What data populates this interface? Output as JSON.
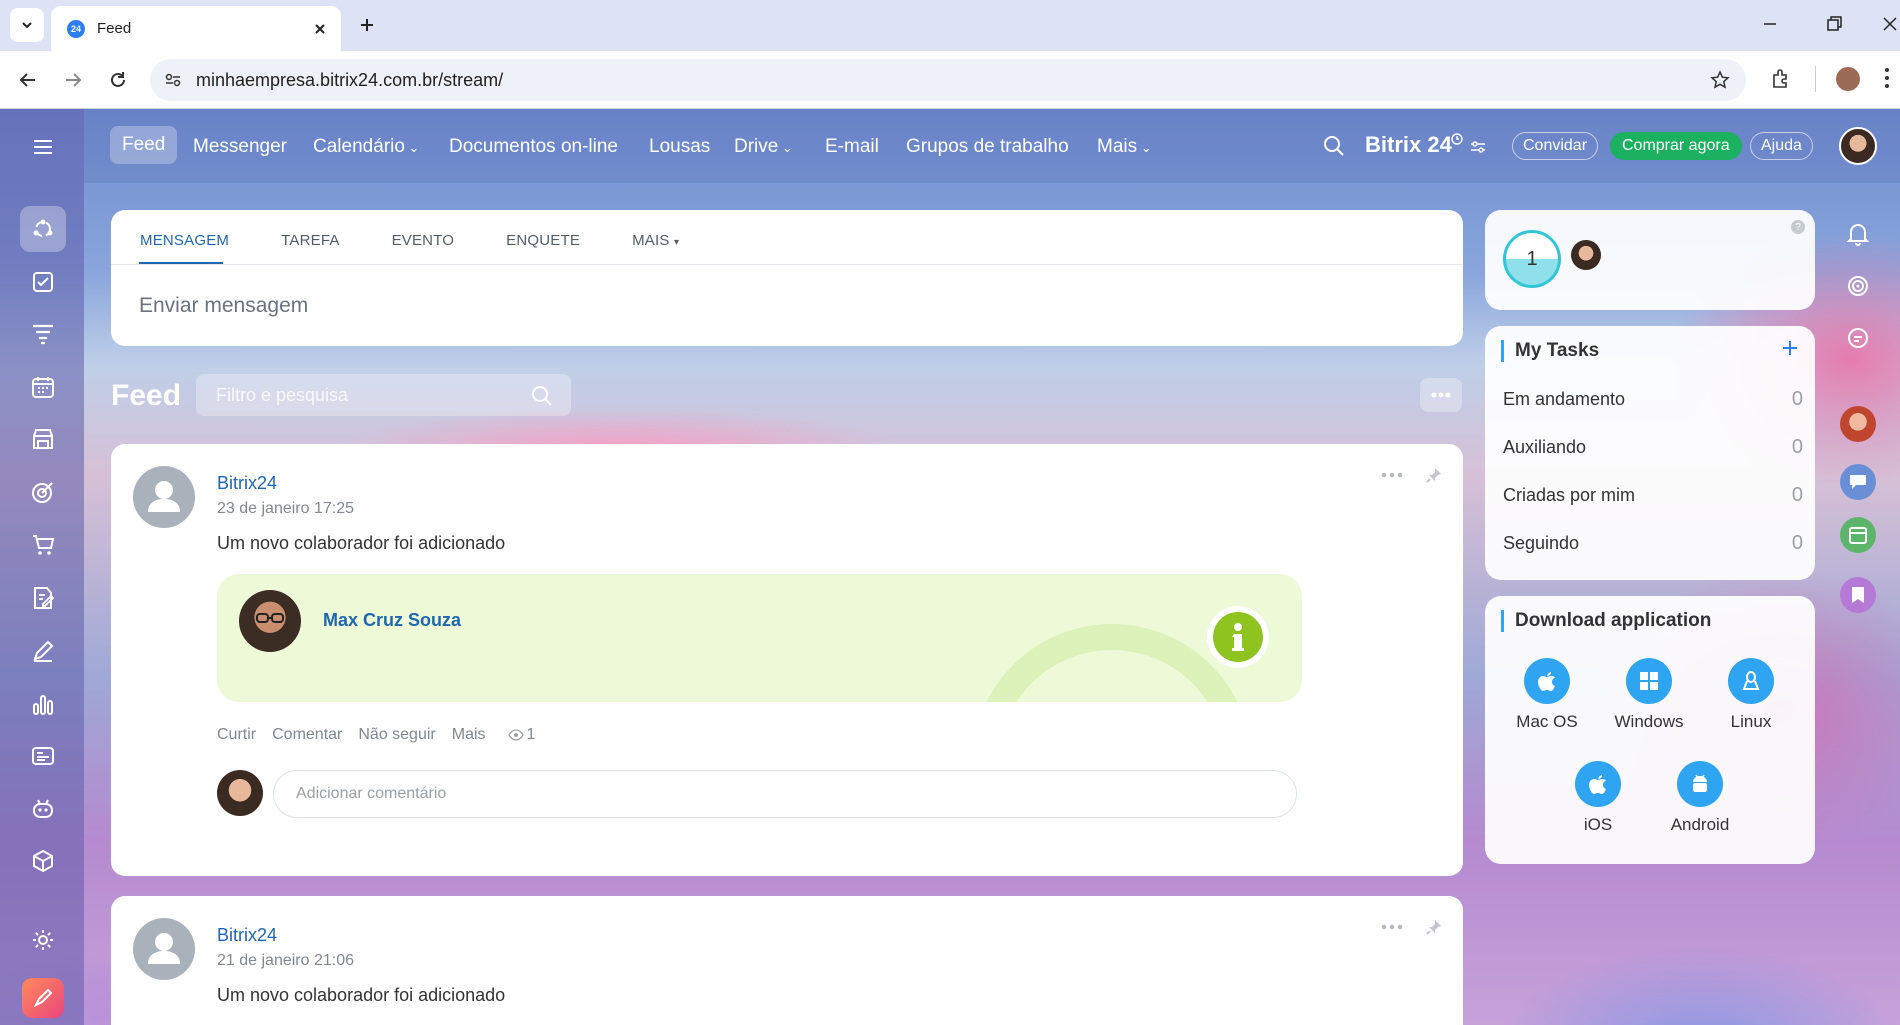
{
  "browser": {
    "tab_title": "Feed",
    "favicon_text": "24",
    "url": "minhaempresa.bitrix24.com.br/stream/"
  },
  "topnav": {
    "items": [
      "Feed",
      "Messenger",
      "Calendário",
      "Documentos on-line",
      "Lousas",
      "Drive",
      "E-mail",
      "Grupos de trabalho",
      "Mais"
    ],
    "logo": "Bitrix 24",
    "invite": "Convidar",
    "buy": "Comprar agora",
    "help": "Ajuda"
  },
  "composer": {
    "tabs": [
      "MENSAGEM",
      "TAREFA",
      "EVENTO",
      "ENQUETE",
      "MAIS"
    ],
    "placeholder": "Enviar mensagem"
  },
  "feed": {
    "title": "Feed",
    "filter_placeholder": "Filtro e pesquisa"
  },
  "posts": [
    {
      "author": "Bitrix24",
      "date": "23 de janeiro 17:25",
      "text": "Um novo colaborador foi adicionado",
      "employee_name": "Max Cruz Souza",
      "actions": [
        "Curtir",
        "Comentar",
        "Não seguir",
        "Mais"
      ],
      "views": "1",
      "comment_placeholder": "Adicionar comentário"
    },
    {
      "author": "Bitrix24",
      "date": "21 de janeiro 21:06",
      "text": "Um novo colaborador foi adicionado"
    }
  ],
  "widgets": {
    "counter_value": "1",
    "tasks": {
      "title": "My Tasks",
      "rows": [
        {
          "label": "Em andamento",
          "count": "0"
        },
        {
          "label": "Auxiliando",
          "count": "0"
        },
        {
          "label": "Criadas por mim",
          "count": "0"
        },
        {
          "label": "Seguindo",
          "count": "0"
        }
      ]
    },
    "download": {
      "title": "Download application",
      "apps": [
        "Mac OS",
        "Windows",
        "Linux",
        "iOS",
        "Android"
      ]
    }
  },
  "colors": {
    "accent": "#2067b0",
    "buy_green": "#1bb160",
    "app_blue": "#2fa4f0",
    "info_green": "#8fc31f"
  }
}
